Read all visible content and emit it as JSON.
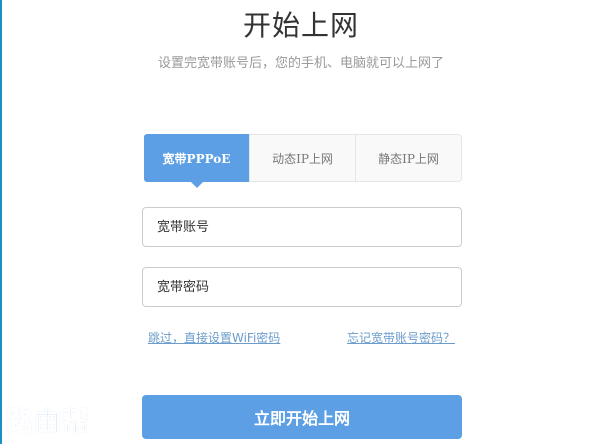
{
  "header": {
    "title": "开始上网",
    "subtitle": "设置完宽带账号后，您的手机、电脑就可以上网了"
  },
  "tabs": [
    {
      "label": "宽带PPPoE",
      "active": true
    },
    {
      "label": "动态IP上网",
      "active": false
    },
    {
      "label": "静态IP上网",
      "active": false
    }
  ],
  "form": {
    "account_placeholder": "宽带账号",
    "password_placeholder": "宽带密码"
  },
  "links": {
    "skip": "跳过，直接设置WiFi密码",
    "forgot": "忘记宽带账号密码？"
  },
  "submit_label": "立即开始上网",
  "watermark": "路由帮",
  "colors": {
    "accent": "#5d9fe4",
    "link": "#6b9ccc"
  }
}
